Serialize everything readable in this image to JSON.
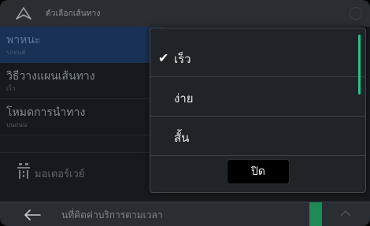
{
  "titlebar": {
    "title": "ตัวเลือกเส้นทาง"
  },
  "left_list": {
    "items": [
      {
        "label": "พาหนะ",
        "sub": "รถยนต์"
      },
      {
        "label": "วิธีวางแผนเส้นทาง",
        "sub": "เร็ว"
      },
      {
        "label": "โหมดการนำทาง",
        "sub": "บนถนน"
      },
      {
        "label": "",
        "sub": ""
      },
      {
        "label": "มอเตอร์เวย์"
      }
    ]
  },
  "bottombar": {
    "caption": "นที่คิดค่าบริการตามเวลา"
  },
  "popup": {
    "options": [
      {
        "label": "เร็ว",
        "checked": true,
        "check": "✔"
      },
      {
        "label": "ง่าย",
        "checked": false
      },
      {
        "label": "สั้น",
        "checked": false
      }
    ],
    "close_label": "ปิด"
  },
  "colors": {
    "accent": "#25c488",
    "selected_row": "#1e3a63",
    "toggle_green": "#1d8a58"
  },
  "icons": [
    "navigation-arrow-icon",
    "status-icon",
    "motorway-icon",
    "back-arrow-icon",
    "chevron-up-icon",
    "check-icon"
  ]
}
